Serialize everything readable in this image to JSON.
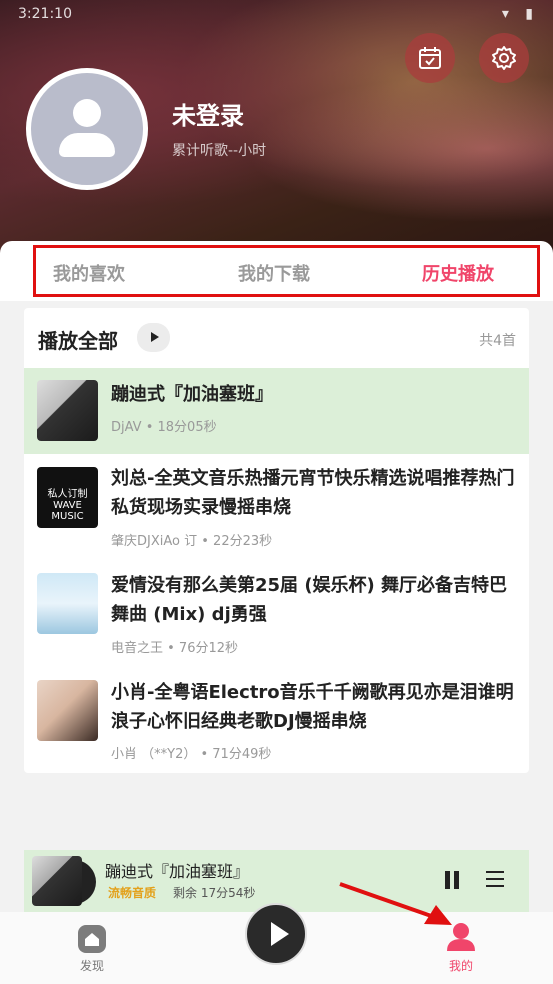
{
  "status": {
    "time": "3:21:10"
  },
  "profile": {
    "name": "未登录",
    "listen_time": "累计听歌--小时"
  },
  "tabs": [
    {
      "label": "我的喜欢",
      "active": false
    },
    {
      "label": "我的下载",
      "active": false
    },
    {
      "label": "历史播放",
      "active": true
    }
  ],
  "list": {
    "play_all": "播放全部",
    "count": "共4首"
  },
  "songs": [
    {
      "title": "蹦迪式『加油塞班』",
      "meta": "DjAV • 18分05秒",
      "active": true
    },
    {
      "title": "刘总-全英文音乐热播元宵节快乐精选说唱推荐热门私货现场实录慢摇串烧",
      "meta": "肇庆DJXiAo 订 • 22分23秒",
      "cover_text": "私人订制 WAVE MUSIC"
    },
    {
      "title": "爱情没有那么美第25届 (娱乐杯) 舞厅必备吉特巴舞曲 (Mix) dj勇强",
      "meta": "电音之王 • 76分12秒"
    },
    {
      "title": "小肖-全粤语Electro音乐千千阙歌再见亦是泪谁明浪子心怀旧经典老歌DJ慢摇串烧",
      "meta": "小肖 （**Y2） • 71分49秒"
    }
  ],
  "player": {
    "title": "蹦迪式『加油塞班』",
    "quality": "流畅音质",
    "remaining": "剩余 17分54秒"
  },
  "nav": {
    "discover": "发现",
    "mine": "我的"
  },
  "colors": {
    "accent": "#f0456a",
    "active_row": "#dcefd8",
    "highlight_box": "#e01010"
  }
}
